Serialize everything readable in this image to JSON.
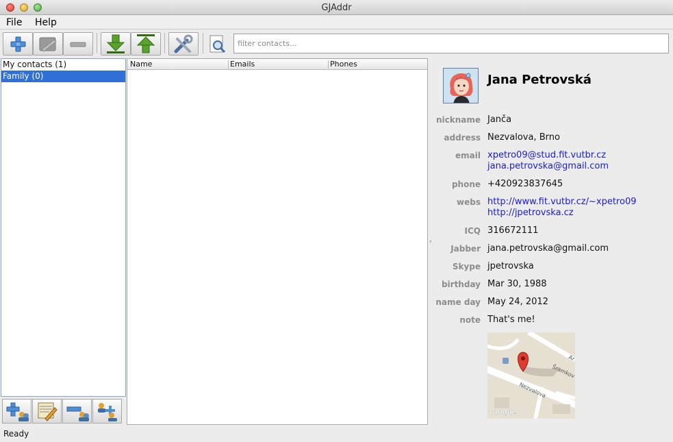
{
  "window": {
    "title": "GJAddr"
  },
  "menu": {
    "items": [
      "File",
      "Help"
    ]
  },
  "toolbar": {
    "filter_placeholder": "filter contacts...",
    "icons": [
      "add-contact-icon",
      "edit-contact-icon",
      "remove-contact-icon",
      "import-icon",
      "export-icon",
      "settings-icon",
      "search-icon"
    ]
  },
  "groups": {
    "items": [
      {
        "label": "My contacts (1)",
        "selected": false
      },
      {
        "label": "Family (0)",
        "selected": true
      }
    ],
    "buttons": [
      "add-group-icon",
      "edit-group-icon",
      "remove-group-icon",
      "manage-groups-icon"
    ]
  },
  "table": {
    "columns": [
      "Name",
      "Emails",
      "Phones"
    ],
    "rows": []
  },
  "contact": {
    "name": "Jana Petrovská",
    "fields": [
      {
        "label": "nickname",
        "values": [
          "Janča"
        ],
        "link": false
      },
      {
        "label": "address",
        "values": [
          "Nezvalova, Brno"
        ],
        "link": false
      },
      {
        "label": "email",
        "values": [
          "xpetro09@stud.fit.vutbr.cz",
          "jana.petrovska@gmail.com"
        ],
        "link": true
      },
      {
        "label": "phone",
        "values": [
          "+420923837645"
        ],
        "link": false
      },
      {
        "label": "webs",
        "values": [
          "http://www.fit.vutbr.cz/~xpetro09",
          "http://jpetrovska.cz"
        ],
        "link": true
      },
      {
        "label": "ICQ",
        "values": [
          "316672111"
        ],
        "link": false
      },
      {
        "label": "Jabber",
        "values": [
          "jana.petrovska@gmail.com"
        ],
        "link": false
      },
      {
        "label": "Skype",
        "values": [
          "jpetrovska"
        ],
        "link": false
      },
      {
        "label": "birthday",
        "values": [
          "Mar 30, 1988"
        ],
        "link": false
      },
      {
        "label": "name day",
        "values": [
          "May 24, 2012"
        ],
        "link": false
      },
      {
        "label": "note",
        "values": [
          "That's me!"
        ],
        "link": false
      }
    ],
    "map": {
      "streets": [
        "Nezvalova",
        "Šramkov",
        "Ar"
      ],
      "attribution": "Google"
    }
  },
  "status": {
    "text": "Ready"
  },
  "colors": {
    "selection": "#2f6fd6",
    "link": "#1a1ad6",
    "label": "#8c8c8c"
  }
}
